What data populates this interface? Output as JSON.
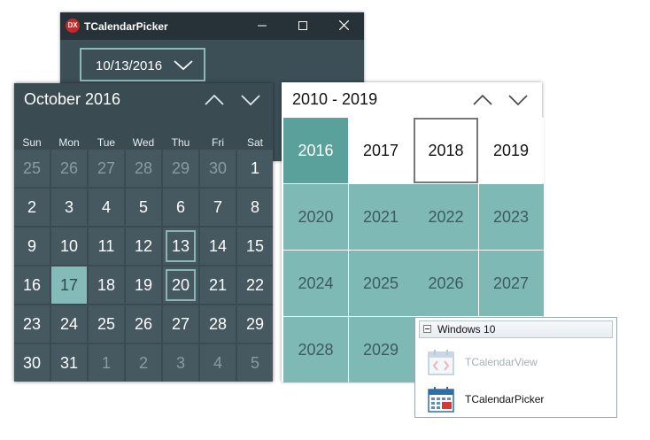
{
  "window": {
    "title": "TCalendarPicker",
    "app_icon_text": "DX",
    "picker_value": "10/13/2016"
  },
  "month_view": {
    "title": "October 2016",
    "weekdays": [
      "Sun",
      "Mon",
      "Tue",
      "Wed",
      "Thu",
      "Fri",
      "Sat"
    ],
    "rows": [
      [
        "25",
        "26",
        "27",
        "28",
        "29",
        "30",
        "1"
      ],
      [
        "2",
        "3",
        "4",
        "5",
        "6",
        "7",
        "8"
      ],
      [
        "9",
        "10",
        "11",
        "12",
        "13",
        "14",
        "15"
      ],
      [
        "16",
        "17",
        "18",
        "19",
        "20",
        "21",
        "22"
      ],
      [
        "23",
        "24",
        "25",
        "26",
        "27",
        "28",
        "29"
      ],
      [
        "30",
        "31",
        "1",
        "2",
        "3",
        "4",
        "5"
      ]
    ],
    "selected_day": "17",
    "outlined_days": [
      "13",
      "20"
    ]
  },
  "decade_view": {
    "title": "2010 - 2019",
    "rows": [
      [
        "2016",
        "2017",
        "2018",
        "2019"
      ],
      [
        "2020",
        "2021",
        "2022",
        "2023"
      ],
      [
        "2024",
        "2025",
        "2026",
        "2027"
      ],
      [
        "2028",
        "2029"
      ]
    ],
    "selected_year": "2016",
    "current_year": "2018"
  },
  "palette": {
    "category": "Windows 10",
    "items": [
      {
        "label": "TCalendarView",
        "enabled": false
      },
      {
        "label": "TCalendarPicker",
        "enabled": true
      }
    ]
  },
  "colors": {
    "dark_bg": "#3a4b52",
    "teal": "#7fb9b5",
    "teal_selected": "#5aa09b",
    "titlebar": "#263238"
  }
}
